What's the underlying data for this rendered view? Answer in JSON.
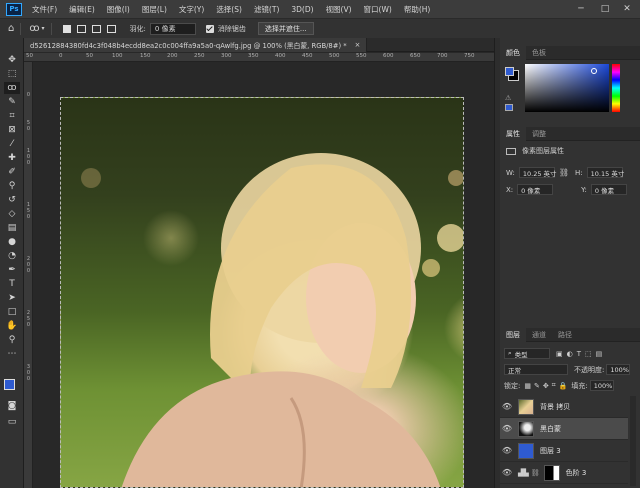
{
  "app_logo": "Ps",
  "menu": [
    "文件(F)",
    "编辑(E)",
    "图像(I)",
    "图层(L)",
    "文字(Y)",
    "选择(S)",
    "滤镜(T)",
    "3D(D)",
    "视图(V)",
    "窗口(W)",
    "帮助(H)"
  ],
  "window_controls": {
    "minimize": "─",
    "maximize": "□",
    "close": "✕"
  },
  "options": {
    "feather_label": "羽化:",
    "feather_value": "0 像素",
    "antialias_label": "消除锯齿",
    "select_mask_button": "选择并遮住..."
  },
  "document_tab": "d52612884380fd4c3f048b4ecdd8ea2c0c004ffa9a5a0-qAwlfg.jpg @ 100% (黑白蒙, RGB/8#) *",
  "document_tab_close": "×",
  "ruler_top": [
    "50",
    "0",
    "50",
    "100",
    "150",
    "200",
    "250",
    "300",
    "350",
    "400",
    "450",
    "500",
    "550",
    "600",
    "650",
    "700",
    "750"
  ],
  "ruler_left": [
    "0",
    "5",
    "0",
    "1",
    "0",
    "0",
    "1",
    "5",
    "0",
    "2",
    "0",
    "0",
    "2",
    "5",
    "0",
    "3",
    "0",
    "0"
  ],
  "color_panel": {
    "tabs": [
      "颜色",
      "色板"
    ],
    "foreground": "#2f5bd0",
    "background": "#000000",
    "accent_hue": "#1b48d8"
  },
  "properties_panel": {
    "tabs": [
      "属性",
      "调整"
    ],
    "subtitle": "像素图层属性",
    "w_label": "W:",
    "w_value": "10.25 英寸",
    "h_label": "H:",
    "h_value": "10.15 英寸",
    "x_label": "X:",
    "x_value": "0 像素",
    "y_label": "Y:",
    "y_value": "0 像素"
  },
  "layers_panel": {
    "tabs": [
      "图层",
      "通道",
      "路径"
    ],
    "filter_label": "类型",
    "blend_mode": "正常",
    "opacity_label": "不透明度:",
    "opacity_value": "100%",
    "lock_label": "锁定:",
    "fill_label": "填充:",
    "fill_value": "100%",
    "layers": [
      {
        "name": "背景 拷贝",
        "selected": false,
        "thumb": "photo"
      },
      {
        "name": "黑白蒙",
        "selected": true,
        "thumb": "bw"
      },
      {
        "name": "图层 3",
        "selected": false,
        "thumb": "blue"
      },
      {
        "name": "色阶 3",
        "selected": false,
        "thumb": "adjust"
      }
    ]
  }
}
